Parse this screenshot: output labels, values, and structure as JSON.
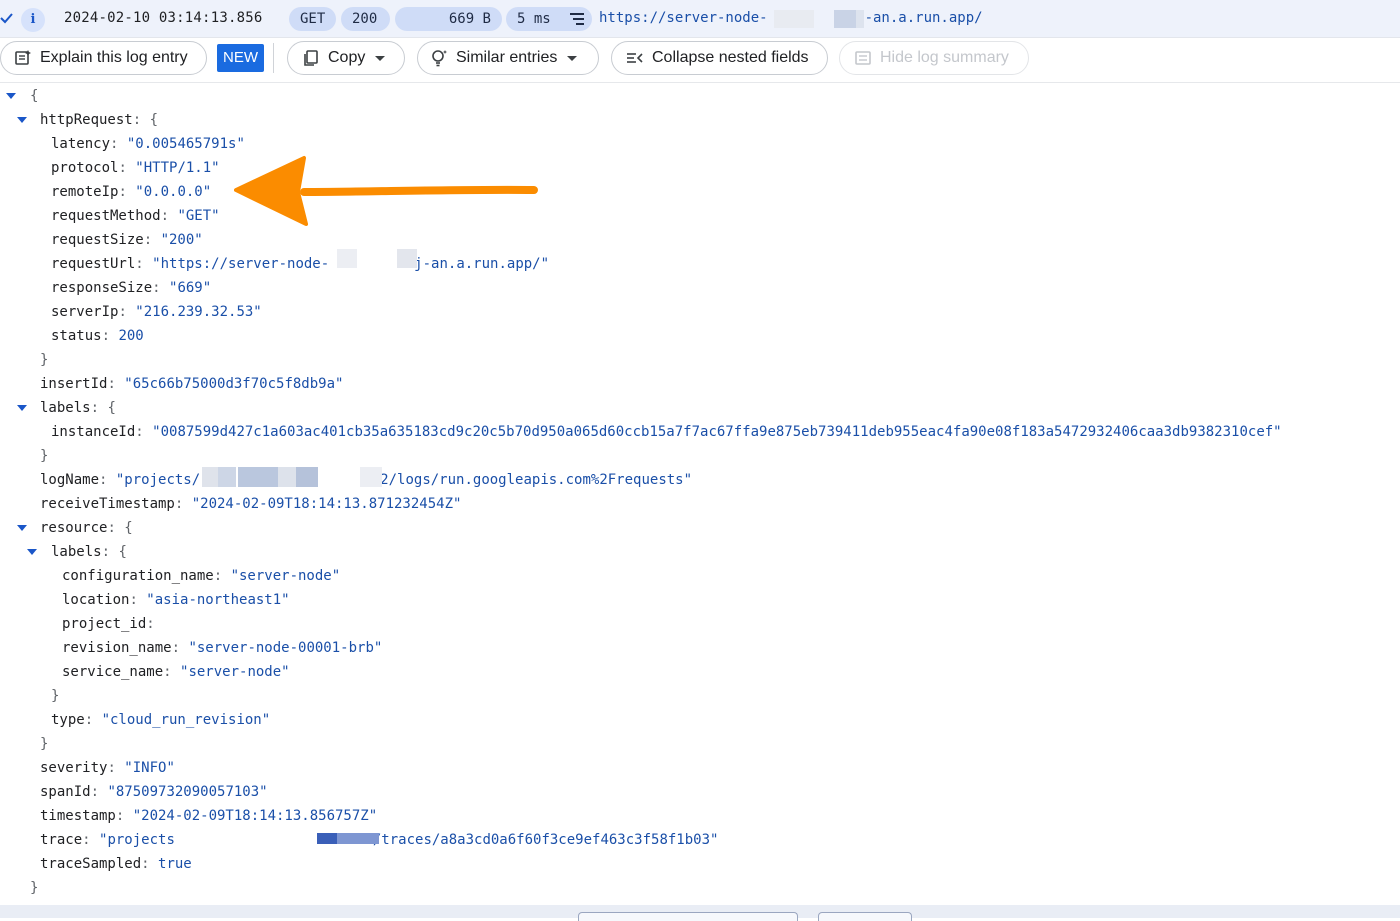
{
  "summary": {
    "timestamp": "2024-02-10 03:14:13.856",
    "method": "GET",
    "status": "200",
    "size": "669 B",
    "latency": "5 ms",
    "url_prefix": "https://server-node-",
    "url_suffix": "-an.a.run.app/",
    "colors": {
      "background": "#eef2fb",
      "chip": "#cfdcf7",
      "url": "#1a4fa8"
    }
  },
  "toolbar": {
    "explain_label": "Explain this log entry",
    "new_badge": "NEW",
    "copy_label": "Copy",
    "similar_label": "Similar entries",
    "collapse_label": "Collapse nested fields",
    "hide_label": "Hide log summary"
  },
  "json_view": {
    "open_brace": "{",
    "close_brace": "}",
    "httpRequest": {
      "key": "httpRequest",
      "fields": [
        {
          "key": "latency",
          "value": "\"0.005465791s\""
        },
        {
          "key": "protocol",
          "value": "\"HTTP/1.1\""
        },
        {
          "key": "remoteIp",
          "value": "\"0.0.0.0\""
        },
        {
          "key": "requestMethod",
          "value": "\"GET\""
        },
        {
          "key": "requestSize",
          "value": "\"200\""
        },
        {
          "key": "requestUrl",
          "value_prefix": "\"https://server-node-",
          "value_suffix": "j-an.a.run.app/\""
        },
        {
          "key": "responseSize",
          "value": "\"669\""
        },
        {
          "key": "serverIp",
          "value": "\"216.239.32.53\""
        },
        {
          "key": "status",
          "value": "200"
        }
      ]
    },
    "insertId": {
      "key": "insertId",
      "value": "\"65c66b75000d3f70c5f8db9a\""
    },
    "labels": {
      "key": "labels",
      "instanceId": {
        "key": "instanceId",
        "value": "\"0087599d427c1a603ac401cb35a635183cd9c20c5b70d950a065d60ccb15a7f7ac67ffa9e875eb739411deb955eac4fa90e08f183a5472932406caa3db9382310cef\""
      }
    },
    "logName": {
      "key": "logName",
      "value_prefix": "\"projects/",
      "value_suffix": "2/logs/run.googleapis.com%2Frequests\""
    },
    "receiveTimestamp": {
      "key": "receiveTimestamp",
      "value": "\"2024-02-09T18:14:13.871232454Z\""
    },
    "resource": {
      "key": "resource",
      "labels": {
        "key": "labels",
        "fields": [
          {
            "key": "configuration_name",
            "value": "\"server-node\""
          },
          {
            "key": "location",
            "value": "\"asia-northeast1\""
          },
          {
            "key": "project_id",
            "value": ""
          },
          {
            "key": "revision_name",
            "value": "\"server-node-00001-brb\""
          },
          {
            "key": "service_name",
            "value": "\"server-node\""
          }
        ]
      },
      "type": {
        "key": "type",
        "value": "\"cloud_run_revision\""
      }
    },
    "severity": {
      "key": "severity",
      "value": "\"INFO\""
    },
    "spanId": {
      "key": "spanId",
      "value": "\"87509732090057103\""
    },
    "timestamp": {
      "key": "timestamp",
      "value": "\"2024-02-09T18:14:13.856757Z\""
    },
    "trace": {
      "key": "trace",
      "value_prefix": "\"projects",
      "value_suffix": "/traces/a8a3cd0a6f60f3ce9ef463c3f58f1b03\""
    },
    "traceSampled": {
      "key": "traceSampled",
      "value": "true"
    }
  },
  "annotation": {
    "arrow_color": "#fb8c00"
  }
}
